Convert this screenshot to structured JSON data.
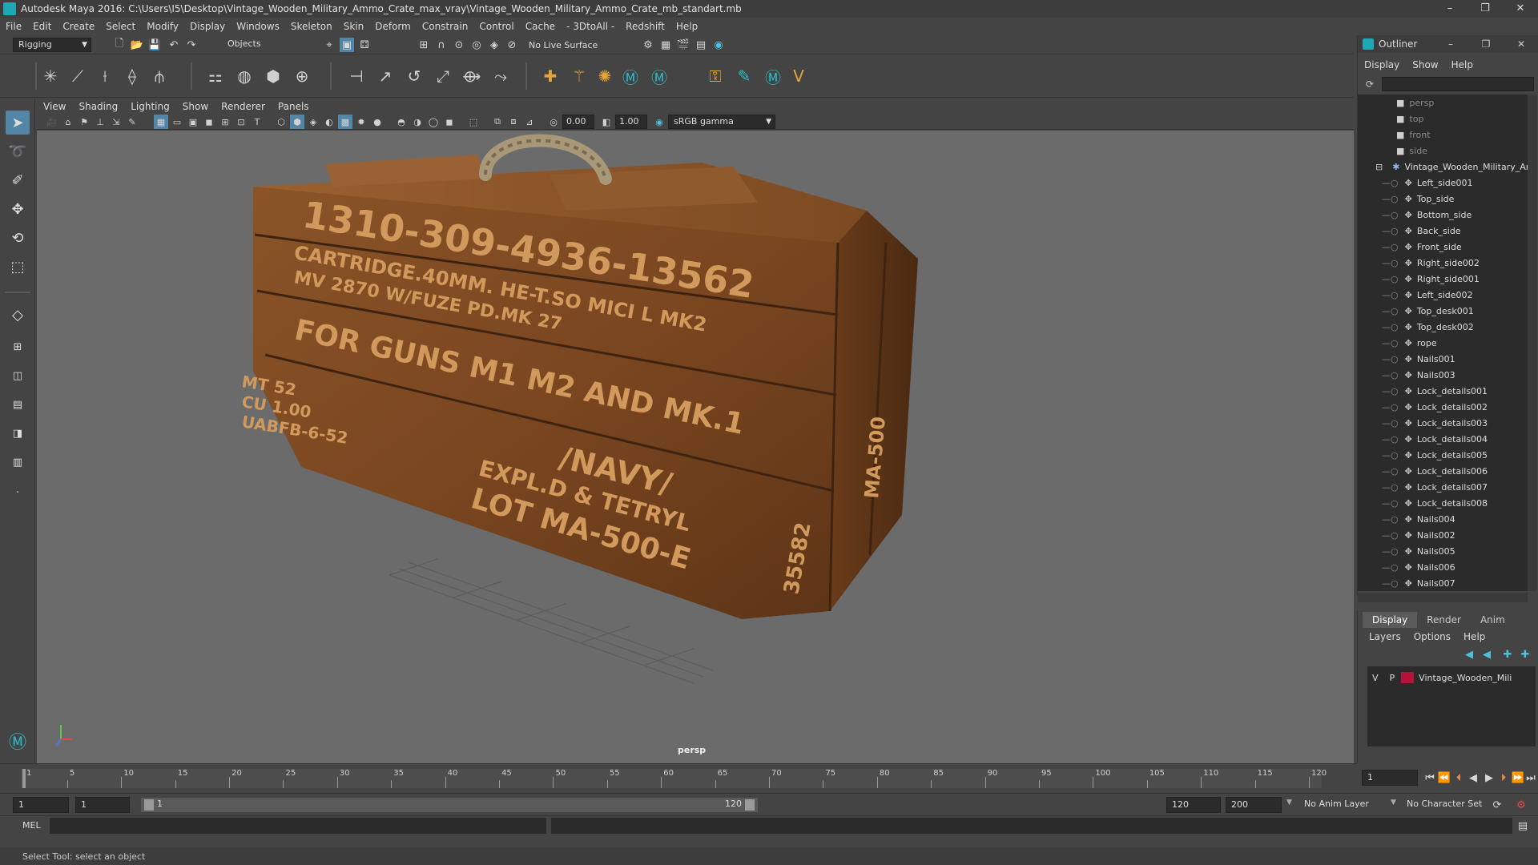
{
  "window": {
    "title": "Autodesk Maya 2016: C:\\Users\\I5\\Desktop\\Vintage_Wooden_Military_Ammo_Crate_max_vray\\Vintage_Wooden_Military_Ammo_Crate_mb_standart.mb",
    "controls": [
      "–",
      "❐",
      "✕"
    ]
  },
  "menubar": [
    "File",
    "Edit",
    "Create",
    "Select",
    "Modify",
    "Display",
    "Windows",
    "Skeleton",
    "Skin",
    "Deform",
    "Constrain",
    "Control",
    "Cache",
    "- 3DtoAll -",
    "Redshift",
    "Help"
  ],
  "statusline": {
    "mode": "Rigging",
    "selection_mode": "Objects",
    "live_surface": "No Live Surface"
  },
  "viewport": {
    "menu": [
      "View",
      "Shading",
      "Lighting",
      "Show",
      "Renderer",
      "Panels"
    ],
    "exposure": "0.00",
    "gamma": "1.00",
    "color_space": "sRGB gamma",
    "camera_label": "persp"
  },
  "outliner": {
    "title": "Outliner",
    "menu": [
      "Display",
      "Show",
      "Help"
    ],
    "items": [
      {
        "label": "persp",
        "type": "camera",
        "dim": true
      },
      {
        "label": "top",
        "type": "camera",
        "dim": true
      },
      {
        "label": "front",
        "type": "camera",
        "dim": true
      },
      {
        "label": "side",
        "type": "camera",
        "dim": true
      },
      {
        "label": "Vintage_Wooden_Military_Ar",
        "type": "group"
      },
      {
        "label": "Left_side001",
        "type": "mesh"
      },
      {
        "label": "Top_side",
        "type": "mesh"
      },
      {
        "label": "Bottom_side",
        "type": "mesh"
      },
      {
        "label": "Back_side",
        "type": "mesh"
      },
      {
        "label": "Front_side",
        "type": "mesh"
      },
      {
        "label": "Right_side002",
        "type": "mesh"
      },
      {
        "label": "Right_side001",
        "type": "mesh"
      },
      {
        "label": "Left_side002",
        "type": "mesh"
      },
      {
        "label": "Top_desk001",
        "type": "mesh"
      },
      {
        "label": "Top_desk002",
        "type": "mesh"
      },
      {
        "label": "rope",
        "type": "mesh"
      },
      {
        "label": "Nails001",
        "type": "mesh"
      },
      {
        "label": "Nails003",
        "type": "mesh"
      },
      {
        "label": "Lock_details001",
        "type": "mesh"
      },
      {
        "label": "Lock_details002",
        "type": "mesh"
      },
      {
        "label": "Lock_details003",
        "type": "mesh"
      },
      {
        "label": "Lock_details004",
        "type": "mesh"
      },
      {
        "label": "Lock_details005",
        "type": "mesh"
      },
      {
        "label": "Lock_details006",
        "type": "mesh"
      },
      {
        "label": "Lock_details007",
        "type": "mesh"
      },
      {
        "label": "Lock_details008",
        "type": "mesh"
      },
      {
        "label": "Nails004",
        "type": "mesh"
      },
      {
        "label": "Nails002",
        "type": "mesh"
      },
      {
        "label": "Nails005",
        "type": "mesh"
      },
      {
        "label": "Nails006",
        "type": "mesh"
      },
      {
        "label": "Nails007",
        "type": "mesh"
      }
    ]
  },
  "layers": {
    "tabs": [
      "Display",
      "Render",
      "Anim"
    ],
    "menu": [
      "Layers",
      "Options",
      "Help"
    ],
    "rows": [
      {
        "v": "V",
        "p": "P",
        "color": "#b5123a",
        "name": "Vintage_Wooden_Mili"
      }
    ]
  },
  "timeline": {
    "ticks": [
      1,
      5,
      10,
      15,
      20,
      25,
      30,
      35,
      40,
      45,
      50,
      55,
      60,
      65,
      70,
      75,
      80,
      85,
      90,
      95,
      100,
      105,
      110,
      115,
      120
    ],
    "current_frame": "1"
  },
  "range": {
    "start": "1",
    "playback_start": "1",
    "slider_start": "1",
    "slider_end": "120",
    "playback_end": "120",
    "end": "200",
    "anim_layer": "No Anim Layer",
    "character_set": "No Character Set"
  },
  "cmdline": {
    "label": "MEL"
  },
  "helpline": {
    "text": "Select Tool: select an object"
  },
  "crate_text": {
    "line1": "1310-309-4936-13562",
    "line2": "CARTRIDGE.40MM. HE-T.SO MICI L MK2",
    "line3": "MV 2870 W/FUZE PD.MK 27",
    "line4": "FOR GUNS M1 M2 AND MK.1",
    "line5": "/NAVY/",
    "line6": "EXPL.D & TETRYL",
    "line7": "LOT MA-500-E",
    "side1": "MT 52",
    "side2": "CU 1.00",
    "side3": "UABFB-6-52",
    "end1": "35582",
    "end2": "MA-500"
  }
}
